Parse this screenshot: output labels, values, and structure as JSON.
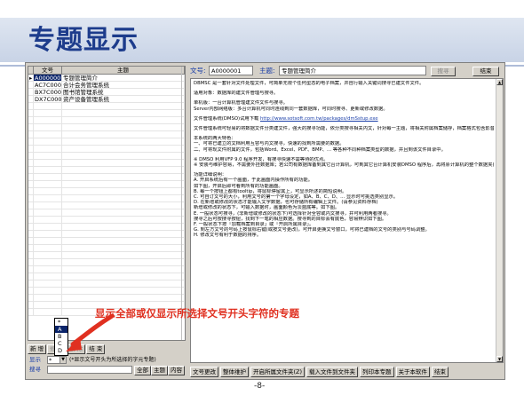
{
  "slide": {
    "title": "专题显示",
    "page_num": "-8-"
  },
  "annotation": "显示全部或仅显示所选择文号开头字符的专题",
  "left_table": {
    "headers": [
      "文号",
      "主题"
    ],
    "rows": [
      {
        "num": "A0000001",
        "topic": "专题管理简介",
        "selected": true
      },
      {
        "num": "AC7C0001",
        "topic": "合计会务管理系统"
      },
      {
        "num": "BX7C0001",
        "topic": "图书馆管理系统"
      },
      {
        "num": "DX7C0001",
        "topic": "资产设备管理系统"
      }
    ]
  },
  "dropdown": {
    "options": [
      "*",
      "A",
      "B",
      "C",
      "D"
    ],
    "highlighted": "A"
  },
  "left_bottom": {
    "buttons": [
      "新",
      "增",
      "修",
      "改",
      "删",
      "除",
      "结",
      "束"
    ],
    "show_label": "显示",
    "show_value": "*",
    "show_hint": "(*显示文号开头为所选择的字元专题)",
    "search_label": "搜寻",
    "btn_all": "全部",
    "btn_topic": "主题",
    "btn_content": "内容"
  },
  "right_top": {
    "num_label": "文号:",
    "num_value": "A0000001",
    "topic_label": "主题:",
    "topic_value": "专题管理简介",
    "search_btn": "搜寻",
    "end_btn": "结束"
  },
  "content_lines": [
    "DBMSC 是一套针对文件处理文件，可简单无限个任何型态的电子档案，并自行输入关键词搜寻已建文件文件。",
    "",
    "适用对象：数据库的建文件管理与搜寻。",
    "",
    "单机版：一台计算机管理建文件文件与搜寻。",
    "Server内部网络版：多台计算机可同时连线到同一套数据库，可同时搜寻、更新或修改数据。",
    "",
    "文件管理系统(DMSO)试用下载  http://www.sotsoft.com.tw/packages/dmSstup.exe",
    "",
    "文件管理系统可轻易的将数据文件分类建文件，强大的搜寻功能，依分类搜寻相关内文，针对每一主题，将相关附属档案储存，档案格式包含影音档、设计档、纸图档等。",
    "",
    "本系统的两大特色：",
    "一、可将已建立的文档利用互容与内文搜寻，快速的找到所需要的数据。",
    "二、可将现文件附属的文件，包括Word、Excel、PDF、BMP、... 等各种不同种档案类型的数据，并且到该文件目录中。",
    "",
    "※ DMSO 利用VFP 9.0 程序开发，有搜寻快速不需等待的优点。",
    "※ 安装与维护容易，不需要外挂数据库；若公司有数据库备到其它台计算机，可到其它台计算机安装DMSO 程序后，再将原计算机的整个数据夹(预设目录在C:\\DMSO)拷贝后到新计算机同样的位置上。",
    "",
    "功能详细说明：",
    "A. 开启系统后有一个画面，于此画面内操作所有的功能。",
    "如下图，开启后即可看到所有的功能画面。",
    "B. 每一个按钮上都有tooltip，将鼠标停留其上，可显示所述的简短说明。",
    "C. 可自订文号的大小，利用文号的第一个字母设定，如A、B、C、D、... 显示时可挑选类别显示。",
    "D. 在新增或修改的状态才能输入文字数据，也可存储所有编辑上文件。(请参见资料存档)",
    "新增或修改的状态下，可输入数据时，画面颜色为淡蓝底等。如下图。",
    "E. 一般状态可搜寻，(非新增或修改的状态下)可选择针对全容或内文搜寻，并可利用两者搜寻。",
    "搜寻之后可按搜寻按钮，找到下一笔的相应数据。搜寻到的目标会有底色，容易辨识如下图。",
    "F. 一般状态下按「加载档案到目录」或「开启所属目录」。",
    "G. 到左方文号的号码上按鼠标右键(或按文号更改)，可开启更换文号窗口，可将已建档的文号的类别与号码调整。",
    "H. 修改文号有利于数据的排序。"
  ],
  "right_bottom": {
    "buttons": [
      "文号更改",
      "整体维护",
      "开启所属文件夹(Z)",
      "载入文件到文件夹",
      "列印本专题",
      "关于本软件",
      "结束"
    ]
  },
  "colors": {
    "title": "#1d3c8c",
    "annotation": "#e03020",
    "selection": "#0a246a",
    "label_blue": "#1a3ea8"
  }
}
